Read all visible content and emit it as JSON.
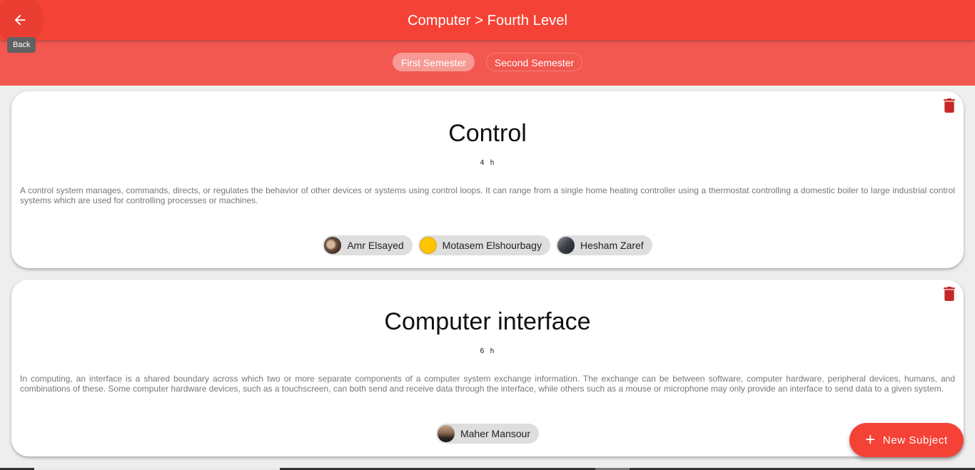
{
  "header": {
    "title": "Computer > Fourth Level",
    "back_tooltip": "Back"
  },
  "tabs": [
    {
      "label": "First Semester",
      "active": true
    },
    {
      "label": "Second Semester",
      "active": false
    }
  ],
  "subjects": [
    {
      "name": "Control",
      "hours": "4 h",
      "description": "A control system manages, commands, directs, or regulates the behavior of other devices or systems using control loops. It can range from a single home heating controller using a thermostat controlling a domestic boiler to large industrial control systems which are used for controlling processes or machines.",
      "instructors": [
        "Amr Elsayed",
        "Motasem Elshourbagy",
        "Hesham Zaref"
      ]
    },
    {
      "name": "Computer interface",
      "hours": "6 h",
      "description": "In computing, an interface is a shared boundary across which two or more separate components of a computer system exchange information. The exchange can be between software, computer hardware, peripheral devices, humans, and combinations of these. Some computer hardware devices, such as a touchscreen, can both send and receive data through the interface, while others such as a mouse or microphone may only provide an interface to send data to a given system.",
      "instructors": [
        "Maher Mansour"
      ]
    }
  ],
  "fab": {
    "label": "New Subject",
    "icon": "plus-icon"
  },
  "colors": {
    "primary": "#f44336",
    "tabbar": "#f25750",
    "delete": "#c62828"
  }
}
